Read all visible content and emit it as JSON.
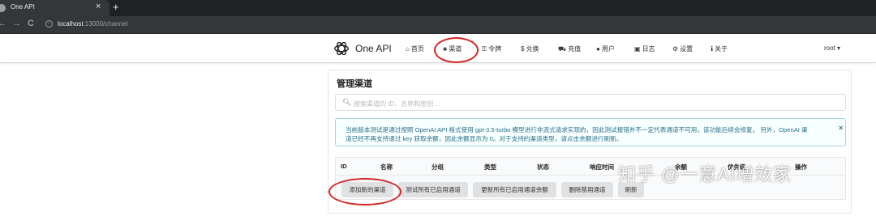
{
  "browser": {
    "tab_title": "One API",
    "tab_close": "×",
    "new_tab": "+",
    "url_host": "localhost",
    "url_rest": ":13000/channel",
    "back": "←",
    "forward": "→",
    "reload": "C"
  },
  "navbar": {
    "brand": "One API",
    "items": [
      {
        "icon": "home-icon",
        "glyph": "⌂",
        "label": "首页"
      },
      {
        "icon": "sitemap-icon",
        "glyph": "♣",
        "label": "渠道"
      },
      {
        "icon": "key-icon",
        "glyph": "⚿",
        "label": "令牌"
      },
      {
        "icon": "dollar-icon",
        "glyph": "$",
        "label": "兑换"
      },
      {
        "icon": "cart-icon",
        "glyph": "⛟",
        "label": "充值"
      },
      {
        "icon": "user-icon",
        "glyph": "●",
        "label": "用户"
      },
      {
        "icon": "calendar-icon",
        "glyph": "▣",
        "label": "日志"
      },
      {
        "icon": "gear-icon",
        "glyph": "⚙",
        "label": "设置"
      },
      {
        "icon": "info-icon",
        "glyph": "ℹ",
        "label": "关于"
      }
    ],
    "user": "root",
    "user_caret": "▾"
  },
  "page": {
    "title": "管理渠道",
    "search_placeholder": "搜索渠道的 ID，名称和密钥 ...",
    "notice_line1": "当前版本测试是通过按照 OpenAI API 格式使用 gpt-3.5-turbo 模型进行非流式请求实现的，因此测试报错并不一定代表通道不可用，该功能后续会修复。 另外，OpenAI 渠",
    "notice_line2": "道已经不再支持通过 key 获取余额，因此余额显示为 0。对于支持的渠道类型，请点击余额进行刷新。",
    "notice_close": "×"
  },
  "table": {
    "headers": [
      "ID",
      "名称",
      "分组",
      "类型",
      "状态",
      "响应时间",
      "余额",
      "优先级",
      "操作"
    ]
  },
  "buttons": {
    "add": "添加新的渠道",
    "test_all": "测试所有已启用通道",
    "update_balance": "更新所有已启用通道余额",
    "delete_disabled": "删除禁用通道",
    "refresh": "刷新"
  },
  "watermark": "知乎 @一意AI增效家",
  "colors": {
    "annotation": "#d32626",
    "notice_text": "#276f86",
    "notice_bg": "#f8ffff",
    "button_bg": "#e0e1e2",
    "chrome_dark": "#35363a"
  }
}
